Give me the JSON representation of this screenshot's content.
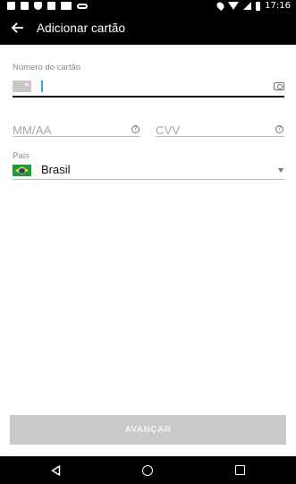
{
  "status_bar": {
    "time": "17:16"
  },
  "app_bar": {
    "title": "Adicionar cartão",
    "back_icon": "arrow-left-icon"
  },
  "card_number": {
    "label": "Número do cartão",
    "value": "",
    "card_icon": "credit-card-icon",
    "scan_icon": "camera-icon"
  },
  "expiry": {
    "placeholder": "MM/AA",
    "help_icon": "help-circle-icon"
  },
  "cvv": {
    "placeholder": "CVV",
    "help_icon": "help-circle-icon"
  },
  "country": {
    "label": "País",
    "value": "Brasil",
    "flag_icon": "brazil-flag-icon"
  },
  "advance_button": {
    "label": "AVANÇAR",
    "enabled": false
  },
  "colors": {
    "bar": "#000000",
    "cursor": "#2ea8e0",
    "button_disabled": "#c9c9c9"
  }
}
